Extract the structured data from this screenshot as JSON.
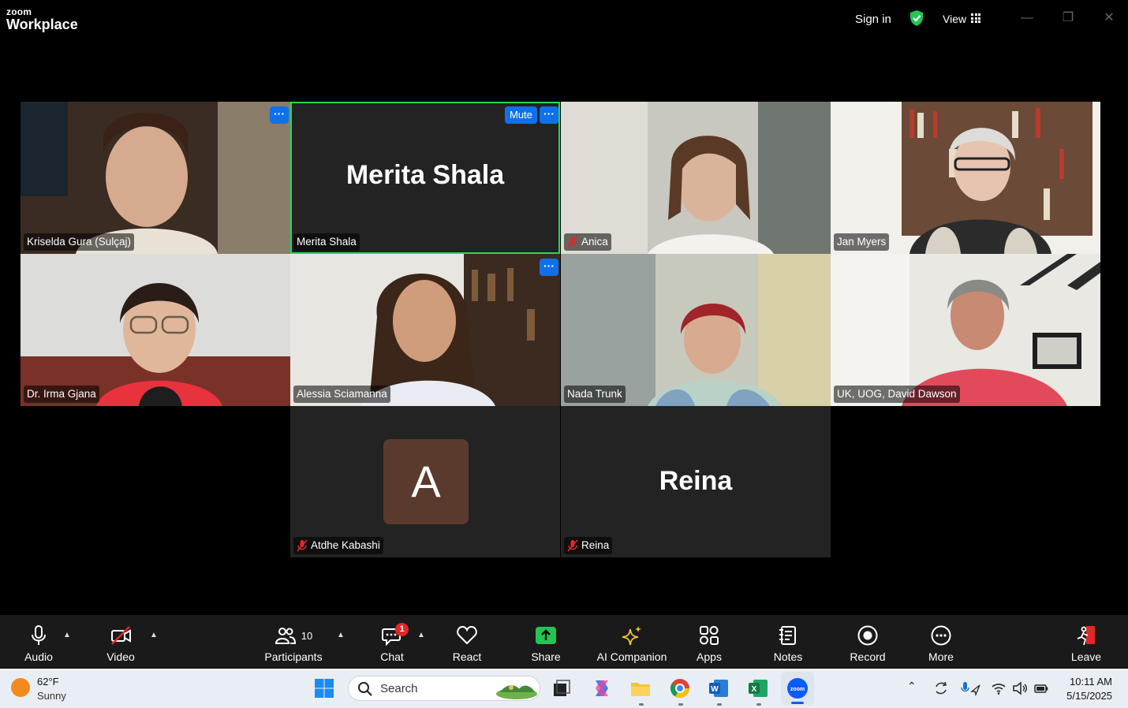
{
  "titlebar": {
    "logo_top": "zoom",
    "logo_bottom": "Workplace",
    "sign_in": "Sign in",
    "view": "View"
  },
  "tiles": [
    {
      "name": "Kriselda Gura (Sulçaj)"
    },
    {
      "name": "Merita Shala",
      "display_name": "Merita Shala",
      "mute_label": "Mute"
    },
    {
      "name": "Anica",
      "muted": true
    },
    {
      "name": "Jan Myers"
    },
    {
      "name": "Dr. Irma Gjana"
    },
    {
      "name": "Alessia Sciamanna"
    },
    {
      "name": "Nada Trunk"
    },
    {
      "name": "UK, UOG, David Dawson"
    },
    {
      "name": "Atdhe Kabashi",
      "avatar_letter": "A",
      "muted": true
    },
    {
      "name": "Reina",
      "display_name": "Reina",
      "muted": true
    }
  ],
  "more_dots": "···",
  "toolbar": {
    "audio": "Audio",
    "video": "Video",
    "participants": "Participants",
    "participants_count": "10",
    "chat": "Chat",
    "chat_badge": "1",
    "react": "React",
    "share": "Share",
    "ai_companion": "AI Companion",
    "apps": "Apps",
    "notes": "Notes",
    "record": "Record",
    "more": "More",
    "leave": "Leave"
  },
  "taskbar": {
    "temperature": "62°F",
    "condition": "Sunny",
    "search_placeholder": "Search",
    "time": "10:11 AM",
    "date": "5/15/2025"
  },
  "colors": {
    "zoom_blue": "#0e71eb",
    "active_speaker": "#23d959",
    "mute_red": "#e02828",
    "share_green": "#23c552"
  }
}
